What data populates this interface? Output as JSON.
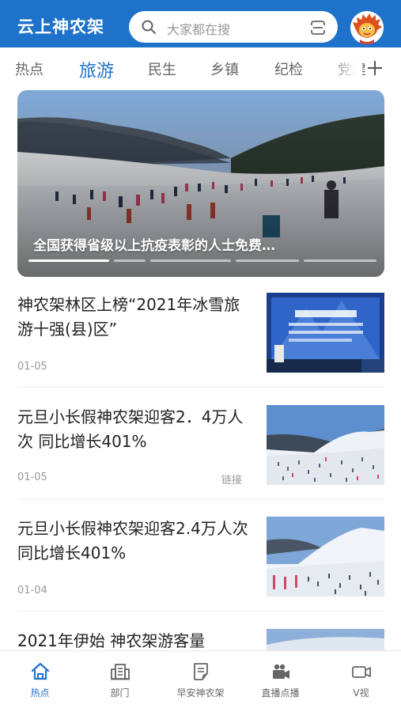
{
  "header": {
    "app_title": "云上神农架",
    "search_placeholder": "大家都在搜"
  },
  "tabs": [
    "热点",
    "旅游",
    "民生",
    "乡镇",
    "纪检",
    "党建"
  ],
  "active_tab": "旅游",
  "banner": {
    "caption": "全国获得省级以上抗疫表彰的人士免费…",
    "slide_count": 5,
    "active_slide": 1
  },
  "news": [
    {
      "title": "神农架林区上榜“2021年冰雪旅游十强(县)区”",
      "date": "01-05",
      "tag": ""
    },
    {
      "title": "元旦小长假神农架迎客2．4万人次 同比增长401%",
      "date": "01-05",
      "tag": "链接"
    },
    {
      "title": "元旦小长假神农架迎客2.4万人次 同比增长401%",
      "date": "01-04",
      "tag": ""
    },
    {
      "title": "2021年伊始 神农架游客量",
      "date": "",
      "tag": ""
    }
  ],
  "bottom_nav": [
    {
      "label": "热点",
      "icon": "home-icon",
      "active": true
    },
    {
      "label": "部门",
      "icon": "building-icon",
      "active": false
    },
    {
      "label": "早安神农架",
      "icon": "notepad-icon",
      "active": false
    },
    {
      "label": "直播点播",
      "icon": "video-camera-icon",
      "active": false
    },
    {
      "label": "V视",
      "icon": "camcorder-icon",
      "active": false
    }
  ],
  "colors": {
    "brand_blue": "#1f72c9",
    "text_dark": "#222222",
    "text_muted": "#999999"
  }
}
